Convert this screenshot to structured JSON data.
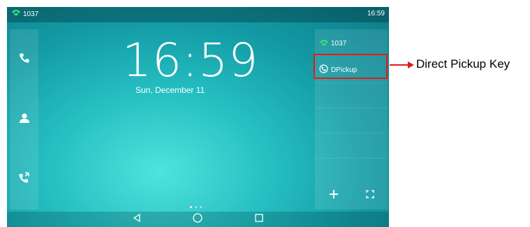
{
  "status": {
    "line": "1037",
    "time": "16:59"
  },
  "home": {
    "time": "16:59",
    "date": "Sun, December 11"
  },
  "panel": {
    "line": "1037",
    "dsskey_label": "DPickup"
  },
  "annotation": {
    "label": "Direct Pickup Key",
    "color": "#e41b17"
  },
  "icons": {
    "status": "phone-handset-icon",
    "left_column": [
      "phone-icon",
      "contact-icon",
      "call-history-icon"
    ],
    "dsskey": "dpickup-icon",
    "footer": [
      "plus-icon",
      "fullscreen-icon"
    ],
    "nav": [
      "back-icon",
      "home-icon",
      "recent-apps-icon"
    ]
  }
}
